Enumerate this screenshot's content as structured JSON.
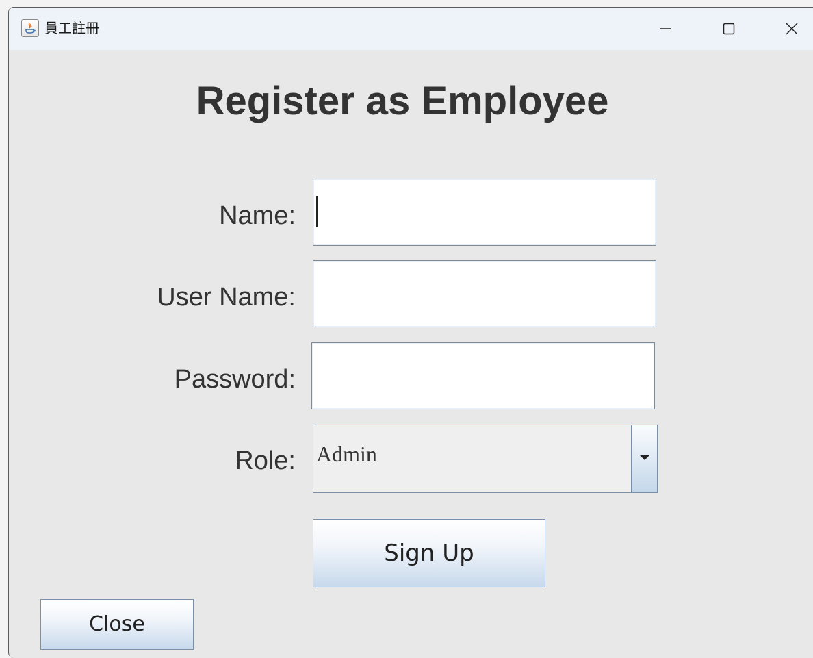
{
  "window": {
    "title": "員工註冊"
  },
  "form": {
    "heading": "Register as Employee",
    "name_label": "Name:",
    "name_value": "",
    "username_label": "User Name:",
    "username_value": "",
    "password_label": "Password:",
    "password_value": "",
    "role_label": "Role:",
    "role_value": "Admin",
    "signup_label": "Sign Up",
    "close_label": "Close"
  },
  "colors": {
    "window_bg": "#e8e8e8",
    "titlebar_bg": "#eef3f9",
    "label_text": "#333333",
    "button_gradient_bottom": "#c7d9ec"
  },
  "icons": [
    "java-app-icon",
    "minimize-icon",
    "maximize-icon",
    "close-icon",
    "chevron-down-icon"
  ]
}
